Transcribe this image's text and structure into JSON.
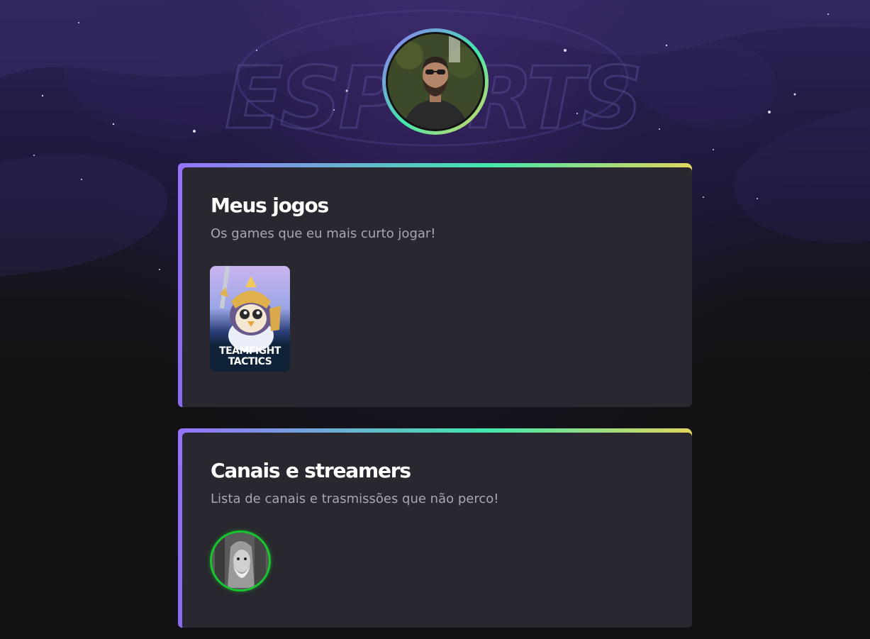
{
  "background": {
    "logo_text": "ESPORTS",
    "colors": {
      "top": "#2d2357",
      "bottom": "#121214"
    }
  },
  "profile": {
    "avatar_icon": "profile-photo",
    "ring_gradient": [
      "#9572fc",
      "#43e7ad",
      "#e1d55d"
    ]
  },
  "sections": {
    "games": {
      "title": "Meus jogos",
      "subtitle": "Os games que eu mais curto jogar!",
      "items": [
        {
          "title_line1": "TEAMFIGHT",
          "title_line2": "TACTICS"
        }
      ]
    },
    "channels": {
      "title": "Canais e streamers",
      "subtitle": "Lista de canais e trasmissões que não perco!",
      "items": [
        {
          "status_color": "#16c72e"
        }
      ]
    }
  },
  "colors": {
    "card_bg": "#29272f",
    "title": "#ffffff",
    "subtitle": "#a8a8b3",
    "accent_purple": "#9572fc",
    "accent_green": "#43e7ad",
    "accent_yellow": "#e1d55d"
  }
}
